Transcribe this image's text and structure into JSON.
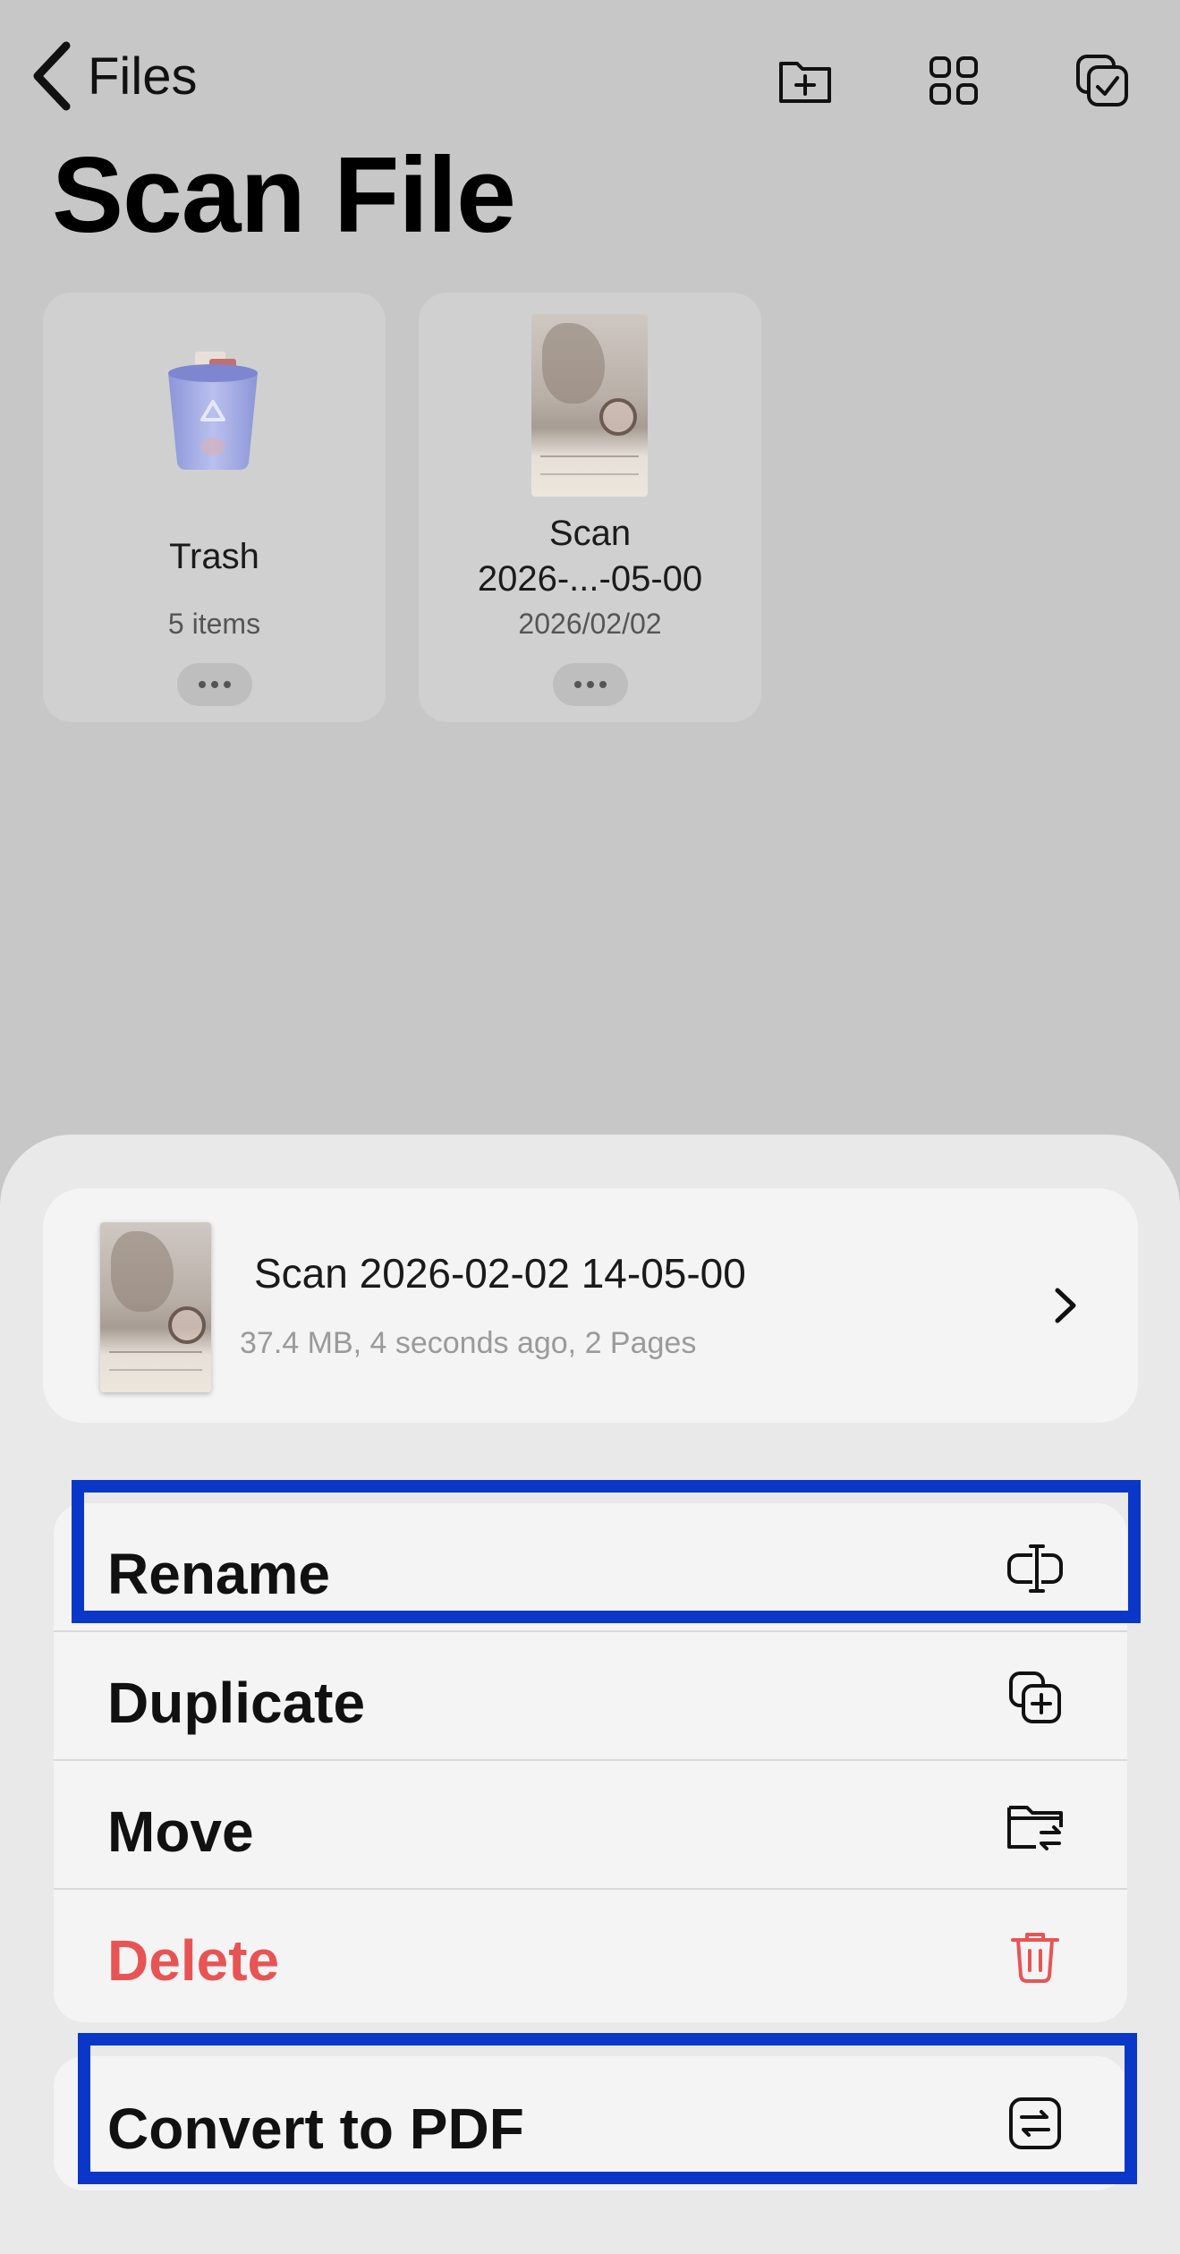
{
  "nav": {
    "back_label": "Files",
    "title": "Scan File",
    "icons": [
      "add-folder-icon",
      "grid-view-icon",
      "select-icon"
    ]
  },
  "files": [
    {
      "name": "Trash",
      "sub": "5 items",
      "icon": "trash-icon"
    },
    {
      "name_line1": "Scan",
      "name_line2": "2026-...-05-00",
      "sub": "2026/02/02",
      "icon": "document-thumbnail"
    }
  ],
  "sheet": {
    "file": {
      "title": "Scan 2026-02-02 14-05-00",
      "meta": "37.4 MB, 4 seconds ago, 2 Pages"
    },
    "menu": [
      {
        "label": "Rename",
        "icon": "rename-icon"
      },
      {
        "label": "Duplicate",
        "icon": "duplicate-icon"
      },
      {
        "label": "Move",
        "icon": "move-folder-icon"
      },
      {
        "label": "Delete",
        "icon": "delete-icon"
      }
    ],
    "extra": {
      "label": "Convert to PDF",
      "icon": "convert-icon"
    }
  },
  "colors": {
    "background": "#c7c7c7",
    "sheet": "#e9e9e9",
    "card": "#f4f4f5",
    "delete": "#e85454",
    "highlight": "#0a37c8"
  }
}
